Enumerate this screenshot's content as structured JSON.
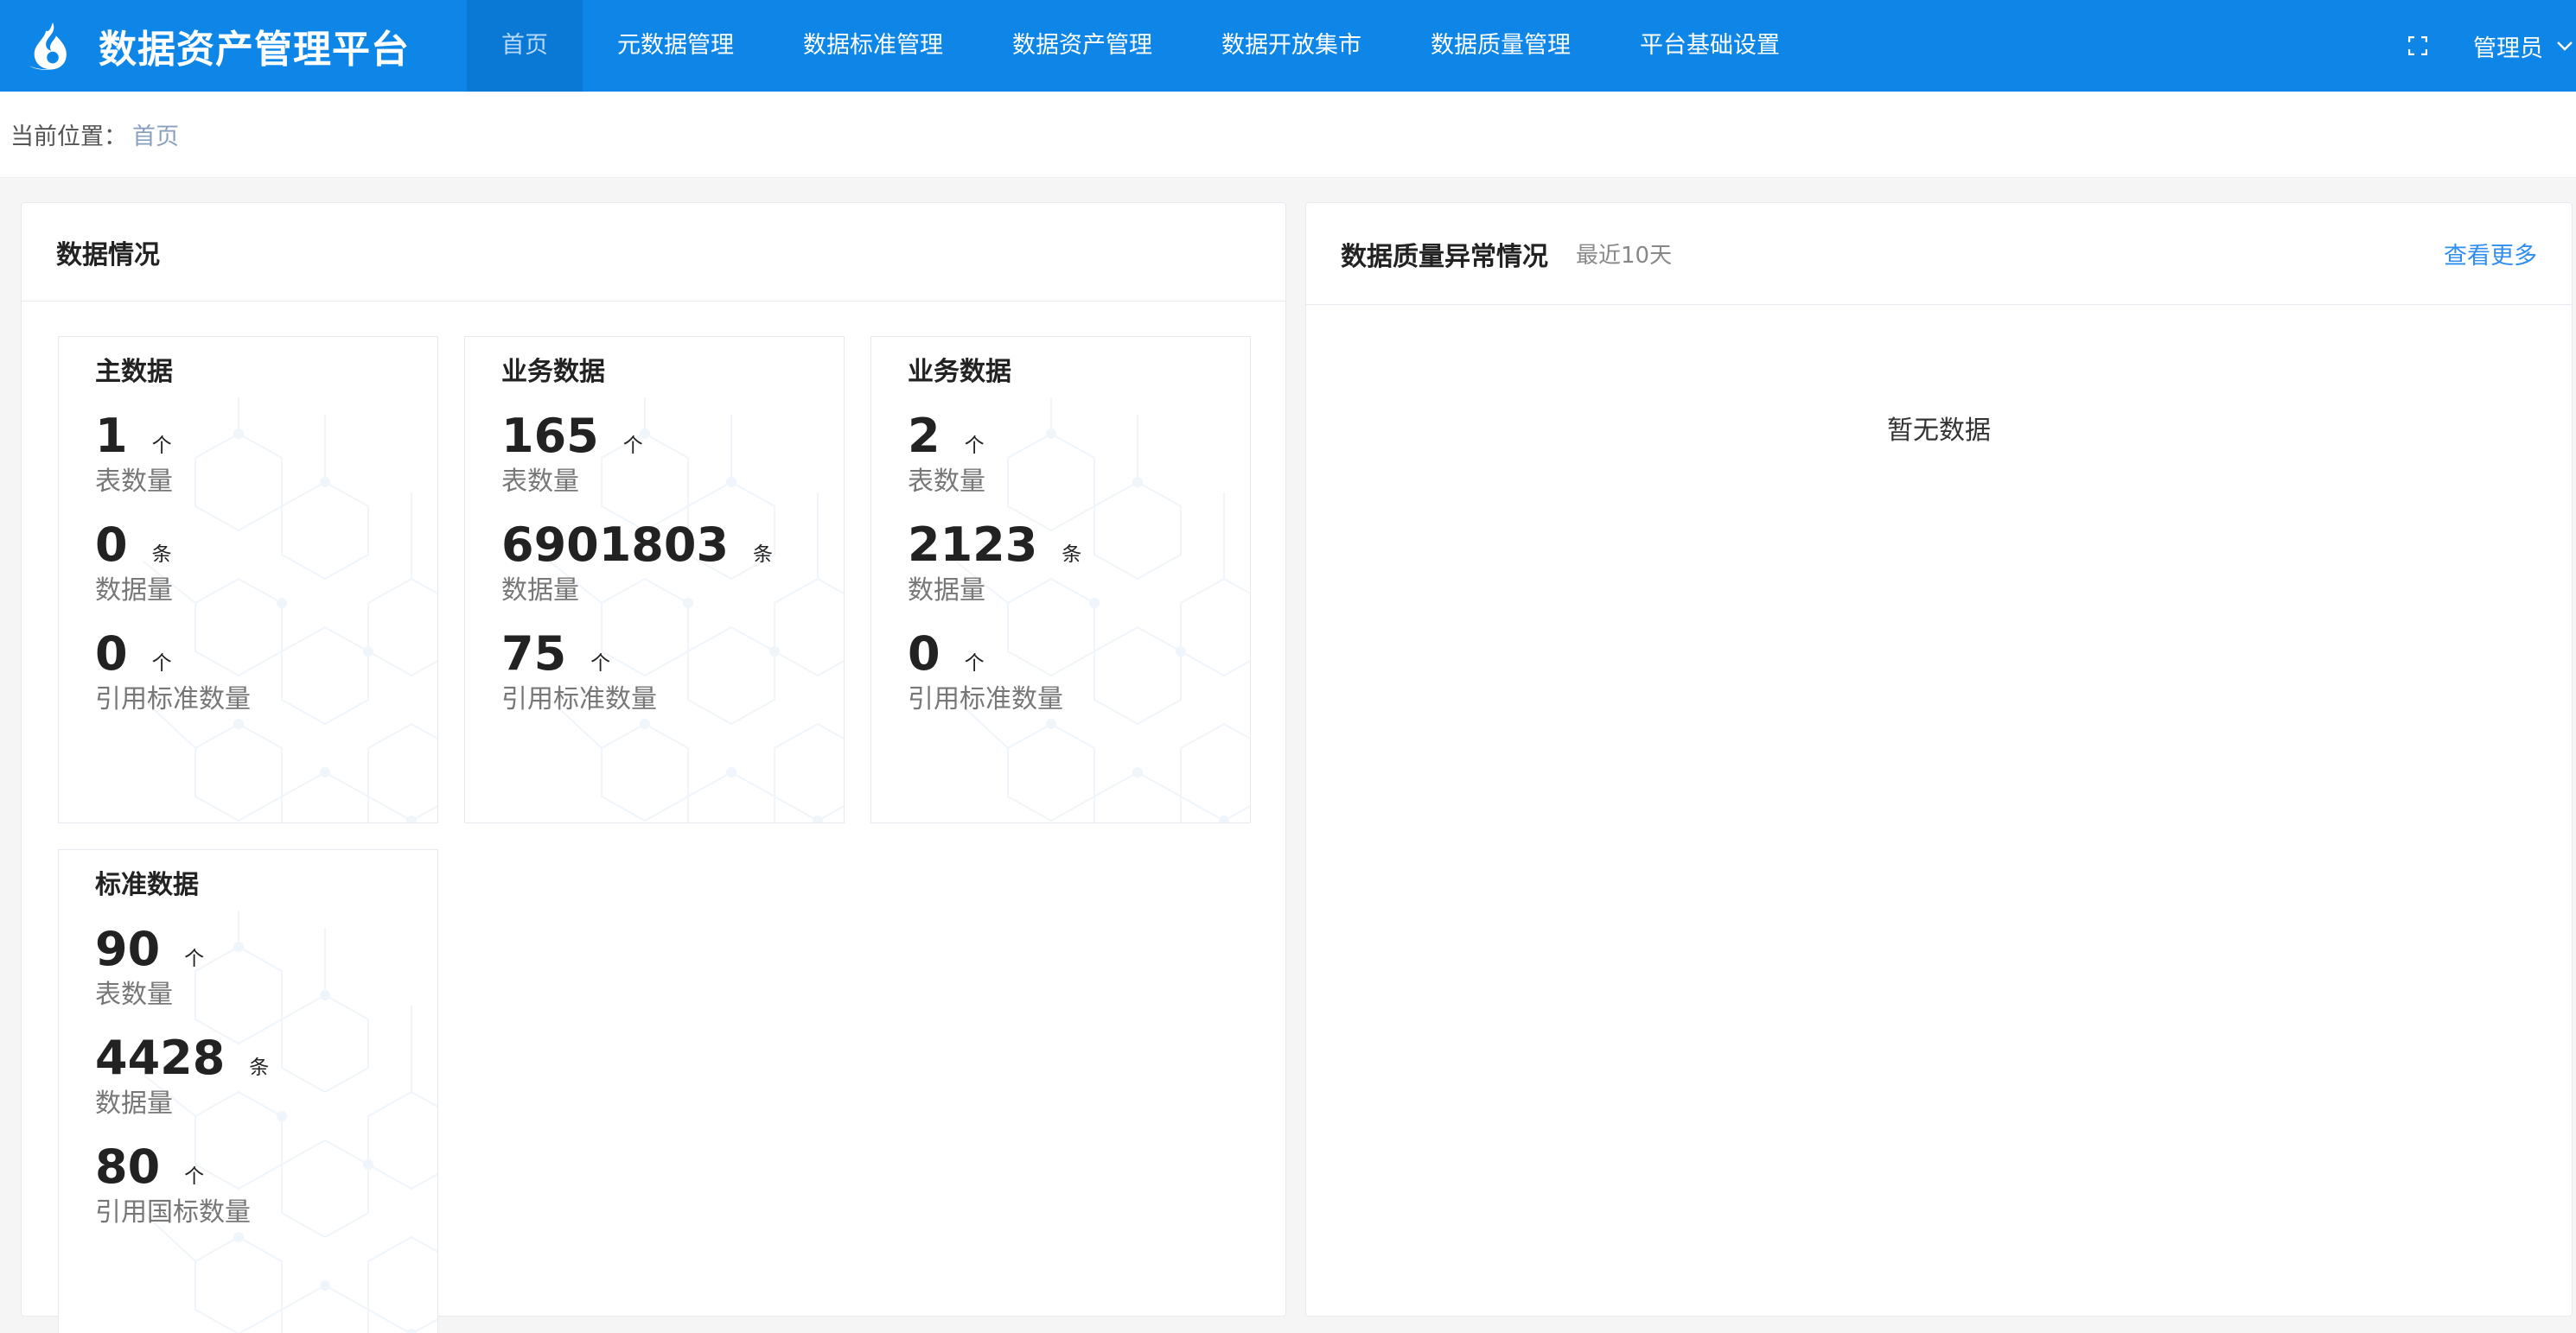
{
  "app": {
    "title": "数据资产管理平台"
  },
  "nav": {
    "items": [
      {
        "label": "首页",
        "active": true
      },
      {
        "label": "元数据管理"
      },
      {
        "label": "数据标准管理"
      },
      {
        "label": "数据资产管理"
      },
      {
        "label": "数据开放集市"
      },
      {
        "label": "数据质量管理"
      },
      {
        "label": "平台基础设置"
      }
    ]
  },
  "user": {
    "name": "管理员"
  },
  "breadcrumb": {
    "prefix": "当前位置：",
    "current": "首页"
  },
  "data_panel": {
    "title": "数据情况",
    "cards": [
      {
        "title": "主数据",
        "stats": [
          {
            "value": "1",
            "unit": "个",
            "label": "表数量"
          },
          {
            "value": "0",
            "unit": "条",
            "label": "数据量"
          },
          {
            "value": "0",
            "unit": "个",
            "label": "引用标准数量"
          }
        ]
      },
      {
        "title": "业务数据",
        "stats": [
          {
            "value": "165",
            "unit": "个",
            "label": "表数量"
          },
          {
            "value": "6901803",
            "unit": "条",
            "label": "数据量"
          },
          {
            "value": "75",
            "unit": "个",
            "label": "引用标准数量"
          }
        ]
      },
      {
        "title": "业务数据",
        "stats": [
          {
            "value": "2",
            "unit": "个",
            "label": "表数量"
          },
          {
            "value": "2123",
            "unit": "条",
            "label": "数据量"
          },
          {
            "value": "0",
            "unit": "个",
            "label": "引用标准数量"
          }
        ]
      },
      {
        "title": "标准数据",
        "stats": [
          {
            "value": "90",
            "unit": "个",
            "label": "表数量"
          },
          {
            "value": "4428",
            "unit": "条",
            "label": "数据量"
          },
          {
            "value": "80",
            "unit": "个",
            "label": "引用国标数量"
          }
        ]
      }
    ]
  },
  "quality_panel": {
    "title": "数据质量异常情况",
    "subtitle": "最近10天",
    "more_label": "查看更多",
    "empty_text": "暂无数据"
  },
  "colors": {
    "brand": "#0d86e8",
    "active_nav_bg": "#0a78d5",
    "link": "#2f8ef0"
  },
  "icons": {
    "logo": "flame-drop-logo",
    "fullscreen": "fullscreen-icon",
    "user_menu": "chevron-down-icon",
    "card_bg": "hexagon-network-pattern"
  }
}
